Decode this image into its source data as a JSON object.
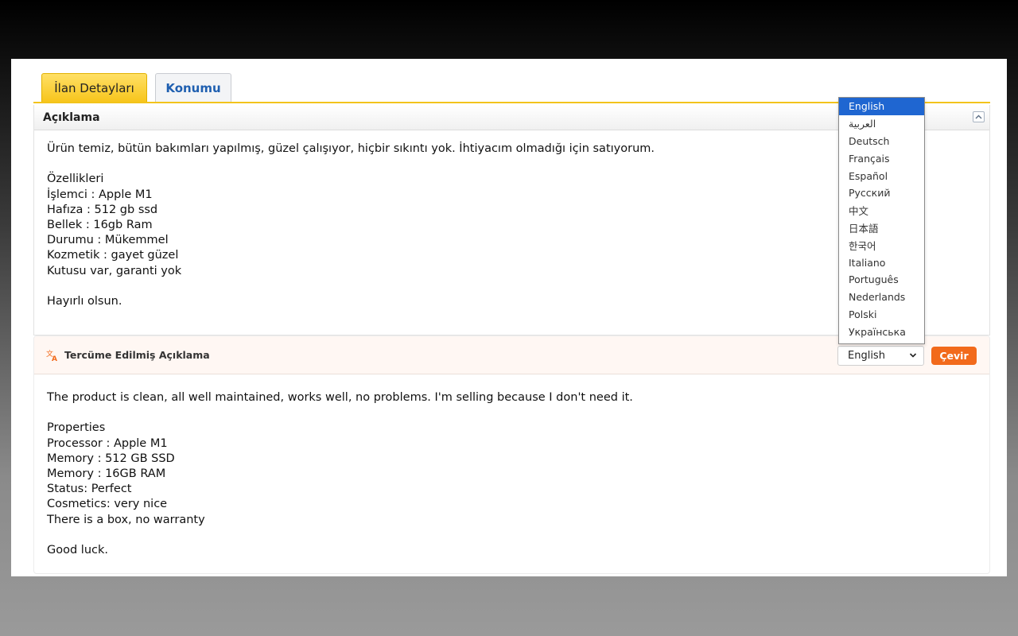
{
  "tabs": {
    "active": "İlan Detayları",
    "inactive": "Konumu"
  },
  "description": {
    "title": "Açıklama",
    "text": "Ürün temiz, bütün bakımları yapılmış, güzel çalışıyor, hiçbir sıkıntı yok. İhtiyacım olmadığı için satıyorum.\n\nÖzellikleri\nİşlemci : Apple M1\nHafıza : 512 gb ssd\nBellek : 16gb Ram\nDurumu : Mükemmel\nKozmetik : gayet güzel\nKutusu var, garanti yok\n\nHayırlı olsun."
  },
  "translation": {
    "title": "Tercüme Edilmiş Açıklama",
    "selected_language": "English",
    "button_label": "Çevir",
    "text": "The product is clean, all well maintained, works well, no problems. I'm selling because I don't need it.\n\nProperties\nProcessor : Apple M1\nMemory : 512 GB SSD\nMemory : 16GB RAM\nStatus: Perfect\nCosmetics: very nice\nThere is a box, no warranty\n\nGood luck."
  },
  "languages": [
    "English",
    "العربية",
    "Deutsch",
    "Français",
    "Español",
    "Русский",
    "中文",
    "日本語",
    "한국어",
    "Italiano",
    "Português",
    "Nederlands",
    "Polski",
    "Українська"
  ],
  "icons": {
    "collapse": "chevron-up-icon",
    "translate": "translate-icon",
    "select": "chevron-down-icon"
  },
  "colors": {
    "tab_active": "#f7c51c",
    "link_blue": "#1f5fb0",
    "translate_orange": "#f26a1b",
    "dropdown_highlight": "#1f66d1"
  }
}
